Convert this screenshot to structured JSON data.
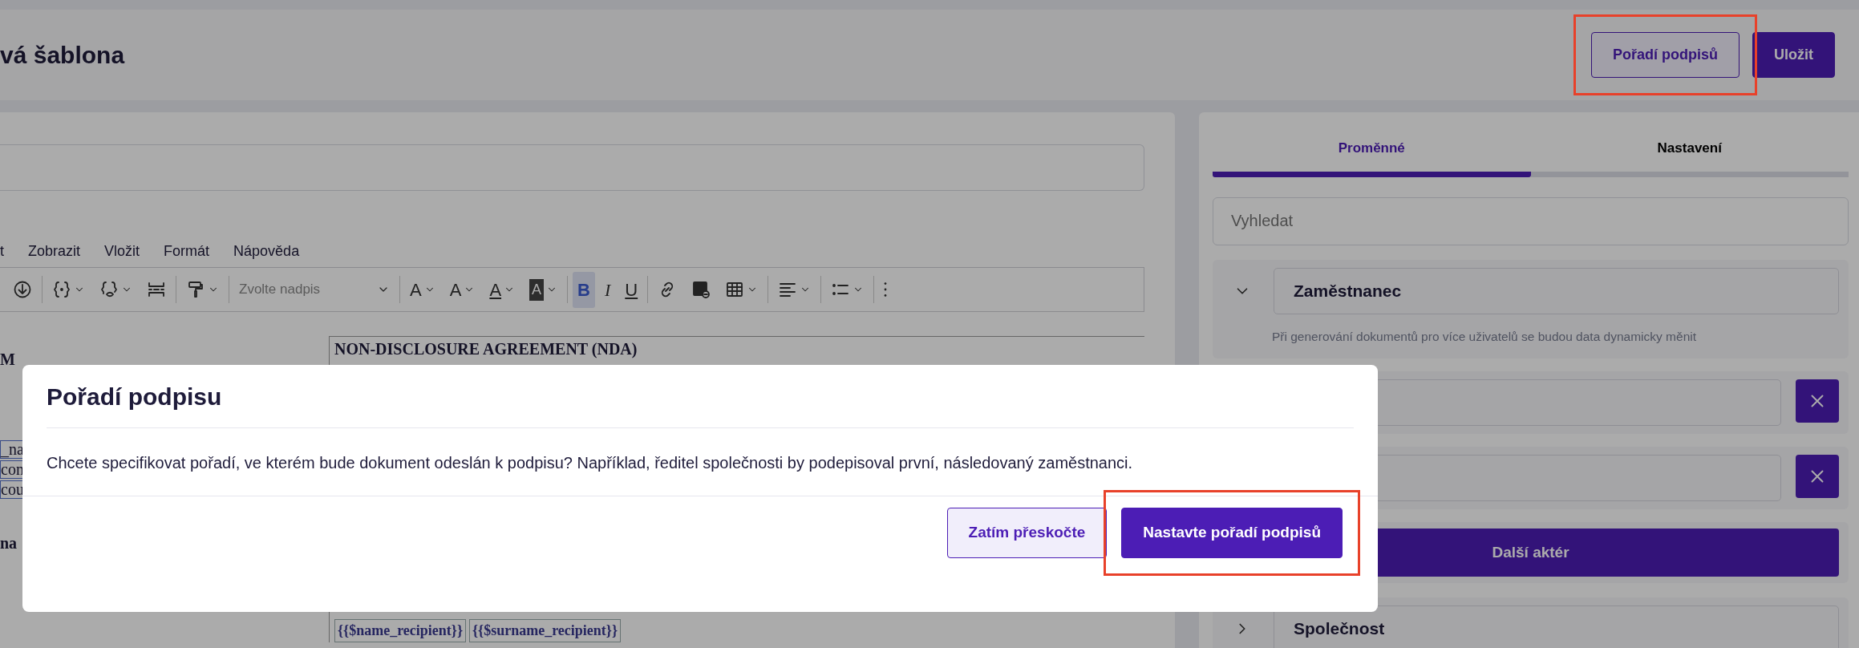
{
  "header": {
    "title": "vá šablona",
    "buttons": [
      {
        "label": "Pořadí podpisů",
        "kind": "outline",
        "highlighted": true
      },
      {
        "label": "Uložit",
        "kind": "primary",
        "highlighted": false
      }
    ]
  },
  "editor": {
    "menu": [
      "t",
      "Zobrazit",
      "Vložit",
      "Formát",
      "Nápověda"
    ],
    "toolbar": [
      {
        "kind": "download"
      },
      {
        "kind": "divider"
      },
      {
        "kind": "braces",
        "dropdown": true
      },
      {
        "kind": "preview",
        "dropdown": true
      },
      {
        "kind": "pagebreak"
      },
      {
        "kind": "divider"
      },
      {
        "kind": "roller",
        "dropdown": true
      },
      {
        "kind": "divider"
      },
      {
        "kind": "heading",
        "placeholder": "Zvolte nadpis",
        "dropdown": true
      },
      {
        "kind": "divider"
      },
      {
        "kind": "fontsize",
        "label": "A",
        "dropdown": true
      },
      {
        "kind": "textstyle",
        "label": "A",
        "dropdown": true
      },
      {
        "kind": "fontcolor",
        "label": "A",
        "dropdown": true
      },
      {
        "kind": "highlight",
        "label": "A",
        "dropdown": true
      },
      {
        "kind": "divider"
      },
      {
        "kind": "bold",
        "label": "B",
        "active": true
      },
      {
        "kind": "italic",
        "label": "I",
        "active": false
      },
      {
        "kind": "underline",
        "label": "U",
        "active": false
      },
      {
        "kind": "divider"
      },
      {
        "kind": "link"
      },
      {
        "kind": "image"
      },
      {
        "kind": "table",
        "dropdown": true
      },
      {
        "kind": "divider"
      },
      {
        "kind": "align",
        "dropdown": true
      },
      {
        "kind": "divider"
      },
      {
        "kind": "list",
        "dropdown": true
      },
      {
        "kind": "divider"
      },
      {
        "kind": "more"
      }
    ],
    "document": {
      "left_fragments": [
        {
          "text": "M",
          "kind": "bold"
        },
        {
          "text": "_na",
          "kind": "field"
        },
        {
          "text": "con",
          "kind": "field"
        },
        {
          "text": "cou",
          "kind": "field"
        },
        {
          "text": "na",
          "kind": "bold"
        }
      ],
      "heading": "NON-DISCLOSURE AGREEMENT (NDA)",
      "placeholders": [
        "{{$name_recipient}}",
        "{{$surname_recipient}}"
      ]
    }
  },
  "side_panel": {
    "tabs": [
      {
        "label": "Proměnné",
        "selected": true
      },
      {
        "label": "Nastavení",
        "selected": false
      }
    ],
    "search": {
      "placeholder": "Vyhledat"
    },
    "groups": [
      {
        "title": "Zaměstnanec",
        "expanded": true,
        "hint": "Při generování dokumentů pro více uživatelů se budou data dynamicky měnit",
        "fields": [
          {
            "removable": true
          },
          {
            "removable": true
          }
        ],
        "add_button": "Další aktér"
      },
      {
        "title": "Společnost",
        "expanded": false
      }
    ]
  },
  "modal": {
    "title": "Pořadí podpisu",
    "body": "Chcete specifikovat pořadí, ve kterém bude dokument odeslán k podpisu? Například, ředitel společnosti by podepisoval první, následovaný zaměstnanci.",
    "buttons": [
      {
        "label": "Zatím přeskočte",
        "kind": "outline",
        "highlighted": false
      },
      {
        "label": "Nastavte pořadí podpisů",
        "kind": "primary",
        "highlighted": true
      }
    ]
  }
}
